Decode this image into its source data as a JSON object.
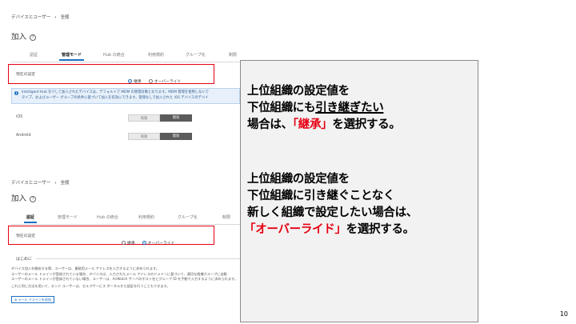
{
  "top": {
    "breadcrumb": [
      "デバイスとユーザー",
      "全般"
    ],
    "breadcrumb_sep": "›",
    "title": "加入",
    "help_glyph": "?",
    "tabs": [
      {
        "label": "認証",
        "active": false
      },
      {
        "label": "管理モード",
        "active": true
      },
      {
        "label": "Hub の統合",
        "active": false
      },
      {
        "label": "利用規約",
        "active": false
      },
      {
        "label": "グループ化",
        "active": false
      },
      {
        "label": "制限",
        "active": false
      }
    ],
    "setting_label": "現在の設定",
    "radio_inherit": "継承",
    "radio_override": "オーバーライド",
    "info_line1": "Intelligent Hub を介して加入されたデバイスは、デフォルトで MDM の管理対象となります。MDM 管理を使用しないで",
    "info_line2": "タイプ、およびユーザー グループの条件に基づいて加入を有効にできます。管理なしで加入された iOS デバイスのデバイ",
    "ios_label": "iOS",
    "android_label": "Android",
    "seg_left": "有効",
    "seg_right": "無効"
  },
  "bottom": {
    "breadcrumb": [
      "デバイスとユーザー",
      "全般"
    ],
    "breadcrumb_sep": "›",
    "title": "加入",
    "help_glyph": "?",
    "tabs": [
      {
        "label": "認証",
        "active": true
      },
      {
        "label": "管理モード",
        "active": false
      },
      {
        "label": "Hub の統合",
        "active": false
      },
      {
        "label": "利用規約",
        "active": false
      },
      {
        "label": "グループ化",
        "active": false
      },
      {
        "label": "制限",
        "active": false
      }
    ],
    "setting_label": "現在の設定",
    "radio_inherit": "継承",
    "radio_override": "オーバーライド",
    "section_title": "はじめに",
    "desc_line1": "デバイス加入を開始する際、ユーザーは、業務用メール アドレスを入力するように求められます。",
    "desc_line2": "ユーザーのメール ドメインが登録されている場合、デバイスは、入力されたメール アドレスのドメインに基づいて、適切な組織グループに自動",
    "desc_line3": "ユーザーのメール ドメインが登録されていない場合、ユーザーは、AirWatch サーバのホスト名とグループ ID を手動で入力するように求められます。",
    "desc_line4": "これと同じ方法を用いて、エンド ユーザーは、セルフサービス ポータルから認証を行うこともできます。",
    "add_domain_button": "メール ドメインを追加"
  },
  "callout": {
    "p1_line1": "上位組織の設定値を",
    "p1_line2_prefix": "下位組織にも",
    "p1_line2_underlined": "引き継ぎたい",
    "p1_line3_prefix": "場合は、",
    "p1_line3_red": "「継承」",
    "p1_line3_suffix": "を選択する。",
    "p2_line1": "上位組織の設定値を",
    "p2_line2": "下位組織に引き継ぐことなく",
    "p2_line3": "新しく組織で設定したい場合は、",
    "p2_line4_red": "「オーバーライド」",
    "p2_line4_suffix": "を選択する。"
  },
  "page_number": "10",
  "colors": {
    "highlight": "#e60012",
    "accent": "#1b6fc2",
    "panel_bg": "#f2f2f2"
  }
}
